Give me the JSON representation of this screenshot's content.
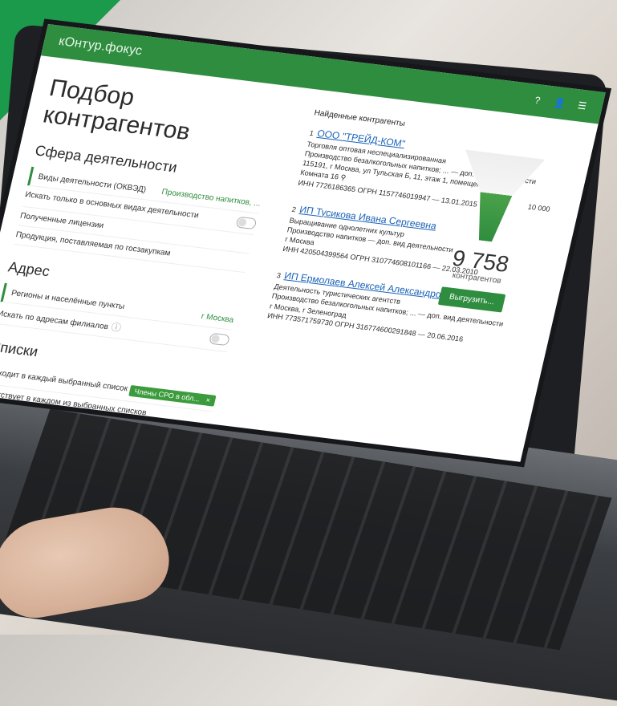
{
  "app": {
    "logo": "кОнтур.фокус"
  },
  "page": {
    "title": "Подбор контрагентов"
  },
  "sections": {
    "activity": {
      "title": "Сфера деятельности",
      "rows": [
        {
          "label": "Виды деятельности (ОКВЭД)",
          "value": "Производство напитков, ..."
        },
        {
          "label": "Искать только в основных видах деятельности"
        },
        {
          "label": "Полученные лицензии"
        },
        {
          "label": "Продукция, поставляемая по госзакупкам"
        }
      ]
    },
    "address": {
      "title": "Адрес",
      "rows": [
        {
          "label": "Регионы и населённые пункты",
          "value": "г Москва"
        },
        {
          "label": "Искать по адресам филиалов"
        }
      ]
    },
    "lists": {
      "title": "Списки",
      "rows": [
        {
          "label": "Входит в каждый выбранный список",
          "chip": "Члены СРО в обл..."
        },
        {
          "label": "Отсутствует в каждом из выбранных списков"
        }
      ]
    }
  },
  "results": {
    "header": "Найденные контрагенты",
    "items": [
      {
        "n": "1",
        "title": "ООО \"ТРЕЙД-КОМ\"",
        "lines": [
          "Торговля оптовая неспециализированная",
          "Производство безалкогольных напитков; ...",
          "— доп. вид деятельности"
        ],
        "address": "115191, г Москва, ул Тульская Б, 11, этаж 1, помещение II,",
        "room": "Комната 16",
        "ids": "ИНН 7726186365   ОГРН 1157746019947 — 13.01.2015"
      },
      {
        "n": "2",
        "title": "ИП Тусикова Ивана Сергеевна",
        "lines": [
          "Выращивание однолетних культур",
          "Производство напитков",
          "— доп. вид деятельности"
        ],
        "address": "г Москва",
        "ids": "ИНН 420504399564   ОГРН 310774608101166 — 22.03.2010"
      },
      {
        "n": "3",
        "title": "ИП Ермолаев Алексей Александрович",
        "lines": [
          "Деятельность туристических агентств",
          "Производство безалкогольных напитков; ...",
          "— доп. вид деятельности"
        ],
        "address": "г Москва, г Зеленоград",
        "ids": "ИНН 773571759730   ОГРН 316774600291848 — 20.06.2016"
      }
    ]
  },
  "summary": {
    "funnel_top": "10 000",
    "count": "9 758",
    "count_label": "контрагентов",
    "download": "Выгрузить..."
  },
  "colors": {
    "brand": "#2f8d3f",
    "accent": "#1a9a4a",
    "link": "#1a63b8"
  },
  "icons": {
    "help": "question-icon",
    "user": "user-icon",
    "menu": "menu-icon",
    "info": "info-icon",
    "location": "location-pin-icon",
    "close": "close-icon"
  }
}
